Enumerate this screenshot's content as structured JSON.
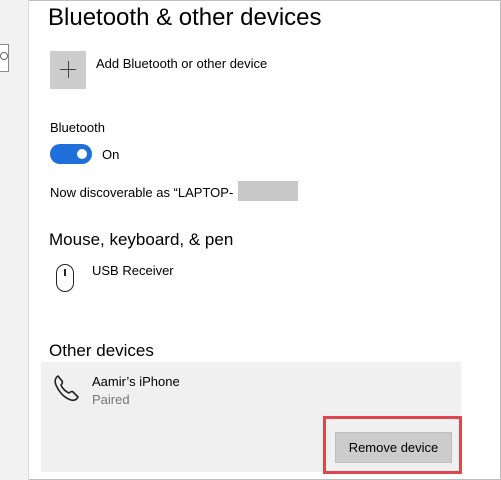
{
  "page": {
    "title": "Bluetooth & other devices"
  },
  "add_device": {
    "label": "Add Bluetooth or other device",
    "icon": "plus-icon"
  },
  "bluetooth": {
    "label": "Bluetooth",
    "toggle_state": "On",
    "toggle_on": true,
    "toggle_color": "#1e6fd9",
    "discoverable_text": "Now discoverable as “LAPTOP-"
  },
  "mouse_section": {
    "heading": "Mouse, keyboard, & pen",
    "devices": [
      {
        "name": "USB Receiver",
        "icon": "mouse-icon"
      }
    ]
  },
  "other_section": {
    "heading": "Other devices",
    "devices": [
      {
        "name": "Aamir’s iPhone",
        "status": "Paired",
        "icon": "phone-icon"
      }
    ],
    "remove_button_label": "Remove device",
    "highlight_color": "#e0454f"
  }
}
